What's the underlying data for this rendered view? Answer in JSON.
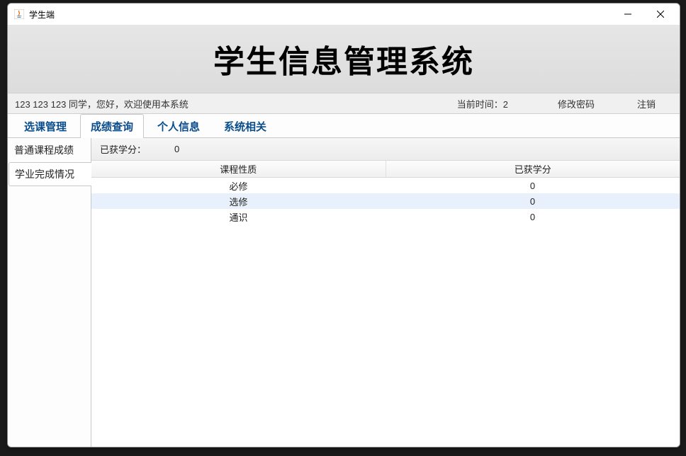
{
  "window": {
    "title": "学生端"
  },
  "banner": {
    "title": "学生信息管理系统"
  },
  "infobar": {
    "welcome": "123 123 123 同学，您好，欢迎使用本系统",
    "time_label": "当前时间：2",
    "change_pw": "修改密码",
    "logout": "注销"
  },
  "tabs": [
    {
      "label": "选课管理",
      "active": false
    },
    {
      "label": "成绩查询",
      "active": true
    },
    {
      "label": "个人信息",
      "active": false
    },
    {
      "label": "系统相关",
      "active": false
    }
  ],
  "sidebar": [
    {
      "label": "普通课程成绩",
      "selected": false
    },
    {
      "label": "学业完成情况",
      "selected": true
    }
  ],
  "credit": {
    "label": "已获学分：",
    "value": "0"
  },
  "table": {
    "headers": [
      "课程性质",
      "已获学分"
    ],
    "rows": [
      {
        "cells": [
          "必修",
          "0"
        ],
        "alt": false
      },
      {
        "cells": [
          "选修",
          "0"
        ],
        "alt": true
      },
      {
        "cells": [
          "通识",
          "0"
        ],
        "alt": false
      }
    ]
  }
}
